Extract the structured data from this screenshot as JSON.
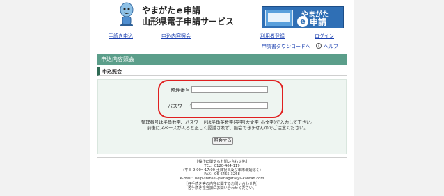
{
  "header": {
    "title_line1": "やまがたｅ申請",
    "title_line2": "山形県電子申請サービス",
    "logo_line1": "やまがた",
    "logo_e": "e",
    "logo_line2": "申請"
  },
  "nav": {
    "items": [
      {
        "label": "手続き申込"
      },
      {
        "label": "申込内容照会"
      },
      {
        "label": "利用者登録"
      },
      {
        "label": "ログイン"
      }
    ]
  },
  "sublinks": {
    "download": "申請書ダウンロードへ",
    "help": "ヘルプ",
    "help_icon": "?"
  },
  "section": {
    "title": "申込内容照会",
    "subtitle": "申込照会"
  },
  "form": {
    "id_label": "整理番号",
    "id_value": "",
    "password_label": "パスワード",
    "password_value": "",
    "note_line1": "整理番号は半角数字、パスワードは半角英数字(英字(大文字･小文字)で入力して下さい。",
    "note_line2": "前後にスペースが入ると正しく認識されず、照会できませんのでご注意ください。",
    "submit_label": "照会する"
  },
  "footer": {
    "lines": [
      "【操作に関するお問い合わせ先】",
      "TEL：0120-464-119",
      "(平日 9:00～17:00 土日祝日及び年末年始除く)",
      "FAX：06-6455-3268",
      "e-mail：help-shinsei-yamagata@s-kantan.com",
      "【各手続き等の内容に関するお問い合わせ先】",
      "各手続き担当課にお問い合わせください。"
    ]
  },
  "colors": {
    "section_bar": "#5b9e8a",
    "form_bg": "#eef5f1",
    "highlight": "#e02020",
    "link": "#1a3fb0"
  }
}
